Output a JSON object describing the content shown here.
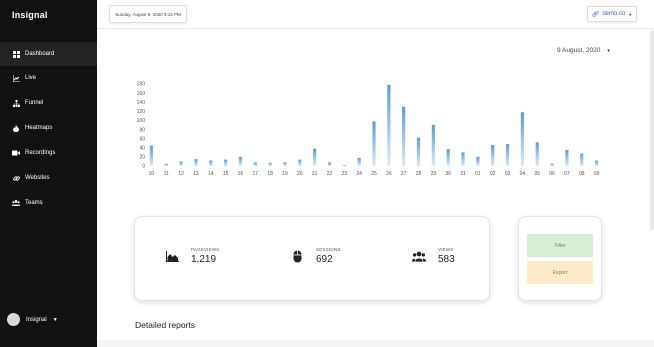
{
  "app": {
    "brand": "Insignal"
  },
  "sidebar": {
    "items": [
      {
        "label": "Dashboard",
        "icon": "dashboard-icon",
        "active": true
      },
      {
        "label": "Live",
        "icon": "chart-icon",
        "active": false
      },
      {
        "label": "Funnel",
        "icon": "sitemap-icon",
        "active": false
      },
      {
        "label": "Heatmaps",
        "icon": "fire-icon",
        "active": false
      },
      {
        "label": "Recordings",
        "icon": "video-icon",
        "active": false
      },
      {
        "label": "Websites",
        "icon": "link-icon",
        "active": false
      },
      {
        "label": "Teams",
        "icon": "users-icon",
        "active": false
      }
    ],
    "user": {
      "name": "Insignal"
    }
  },
  "header": {
    "date_text": "Sunday, August 9, 2020 9:16 PM",
    "site": "demo.co"
  },
  "date_selector": {
    "value": "9 August, 2020"
  },
  "chart_data": {
    "type": "bar",
    "categories": [
      "10",
      "11",
      "12",
      "13",
      "14",
      "15",
      "16",
      "17",
      "18",
      "19",
      "20",
      "21",
      "22",
      "23",
      "24",
      "25",
      "26",
      "27",
      "28",
      "29",
      "30",
      "31",
      "01",
      "02",
      "03",
      "04",
      "05",
      "06",
      "07",
      "08",
      "09"
    ],
    "values": [
      45,
      5,
      10,
      15,
      12,
      14,
      20,
      8,
      7,
      8,
      14,
      38,
      8,
      2,
      18,
      98,
      178,
      130,
      62,
      90,
      37,
      30,
      20,
      46,
      48,
      118,
      52,
      5,
      35,
      27,
      12
    ],
    "yticks": [
      0,
      20,
      40,
      60,
      80,
      100,
      120,
      140,
      160,
      180
    ],
    "ylim": [
      0,
      180
    ],
    "color": "#5b9bd5"
  },
  "stats": {
    "pageviews": {
      "label": "PAGEVIEWS",
      "value": "1,219",
      "icon": "area-chart-icon"
    },
    "sessions": {
      "label": "SESSIONS",
      "value": "692",
      "icon": "mouse-icon"
    },
    "views": {
      "label": "VIEWS",
      "value": "583",
      "icon": "users-icon"
    }
  },
  "actions": {
    "filter": "Filter",
    "export": "Export"
  },
  "reports": {
    "title": "Detailed reports"
  }
}
